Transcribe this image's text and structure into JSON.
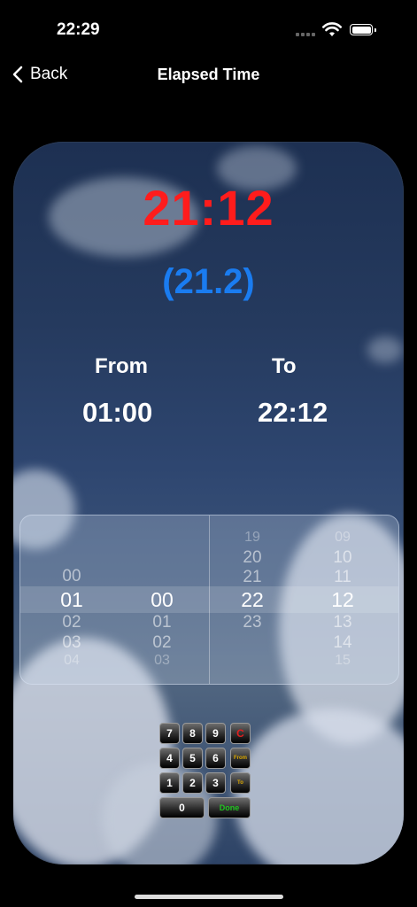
{
  "status": {
    "time": "22:29"
  },
  "nav": {
    "back_label": "Back",
    "title": "Elapsed Time"
  },
  "elapsed": {
    "hhmm": "21:12",
    "decimal": "(21.2)"
  },
  "from": {
    "label": "From",
    "value": "01:00"
  },
  "to": {
    "label": "To",
    "value": "22:12"
  },
  "picker": {
    "from_hours": [
      "00",
      "01",
      "02",
      "03",
      "04"
    ],
    "from_minutes": [
      "00",
      "01",
      "02",
      "03"
    ],
    "to_hours": [
      "19",
      "20",
      "21",
      "22",
      "23"
    ],
    "to_minutes": [
      "09",
      "10",
      "11",
      "12",
      "13",
      "14",
      "15"
    ]
  },
  "keypad": {
    "keys": [
      "7",
      "8",
      "9",
      "C",
      "4",
      "5",
      "6",
      "From",
      "1",
      "2",
      "3",
      "To",
      "0",
      "Done"
    ]
  },
  "colors": {
    "elapsed": "#ff1c1c",
    "decimal": "#1a7cf0",
    "done": "#21c321",
    "clear": "#e02020"
  }
}
